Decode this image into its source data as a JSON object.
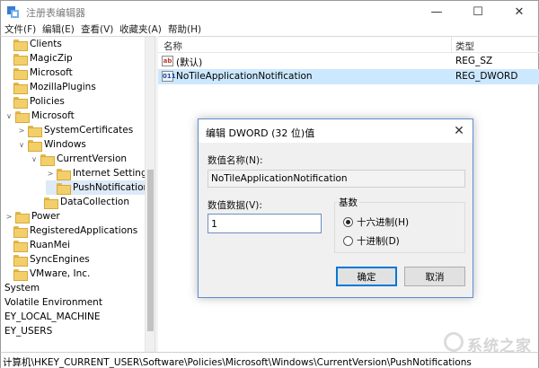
{
  "window": {
    "title": "注册表编辑器",
    "controls": {
      "minimize": "—",
      "maximize": "☐",
      "close": "✕"
    }
  },
  "menu": [
    "文件(F)",
    "编辑(E)",
    "查看(V)",
    "收藏夹(A)",
    "帮助(H)"
  ],
  "tree": [
    {
      "label": "Clients",
      "caret": ""
    },
    {
      "label": "MagicZip",
      "caret": ""
    },
    {
      "label": "Microsoft",
      "caret": ""
    },
    {
      "label": "MozillaPlugins",
      "caret": ""
    },
    {
      "label": "Policies",
      "caret": ""
    },
    {
      "label": "Microsoft",
      "caret": "∨"
    },
    {
      "label": "SystemCertificates",
      "caret": ">"
    },
    {
      "label": "Windows",
      "caret": "∨"
    },
    {
      "label": "CurrentVersion",
      "caret": "∨"
    },
    {
      "label": "Internet Settings",
      "caret": ">"
    },
    {
      "label": "PushNotifications",
      "caret": ""
    },
    {
      "label": "DataCollection",
      "caret": ""
    },
    {
      "label": "Power",
      "caret": ">"
    },
    {
      "label": "RegisteredApplications",
      "caret": ""
    },
    {
      "label": "RuanMei",
      "caret": ""
    },
    {
      "label": "SyncEngines",
      "caret": ""
    },
    {
      "label": "VMware, Inc.",
      "caret": ""
    },
    {
      "label": "System",
      "caret": ""
    },
    {
      "label": "Volatile Environment",
      "caret": ""
    },
    {
      "label": "EY_LOCAL_MACHINE",
      "caret": ""
    },
    {
      "label": "EY_USERS",
      "caret": ""
    }
  ],
  "list": {
    "headers": {
      "name": "名称",
      "type": "类型"
    },
    "rows": [
      {
        "icon": "ab",
        "name": "(默认)",
        "type": "REG_SZ"
      },
      {
        "icon": "011",
        "name": "NoTileApplicationNotification",
        "type": "REG_DWORD"
      }
    ]
  },
  "status": "计算机\\HKEY_CURRENT_USER\\Software\\Policies\\Microsoft\\Windows\\CurrentVersion\\PushNotifications",
  "watermark": "系统之家",
  "dialog": {
    "title": "编辑 DWORD (32 位)值",
    "close": "✕",
    "name_label": "数值名称(N):",
    "name_value": "NoTileApplicationNotification",
    "data_label": "数值数据(V):",
    "data_value": "1",
    "base_label": "基数",
    "radio_hex": "十六进制(H)",
    "radio_dec": "十进制(D)",
    "selected_base": "hex",
    "ok": "确定",
    "cancel": "取消"
  }
}
